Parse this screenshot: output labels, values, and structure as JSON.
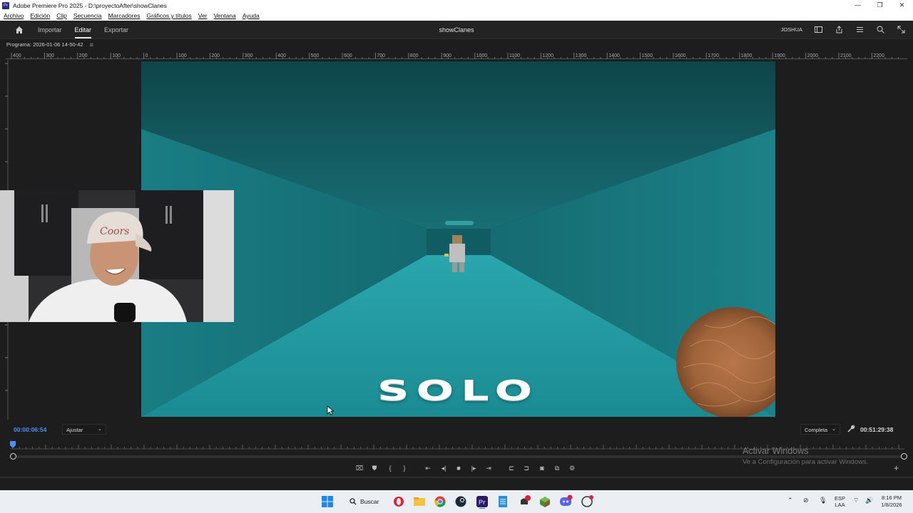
{
  "window": {
    "title": "Adobe Premiere Pro 2025 - D:\\proyectoAfter\\showClanes",
    "app_icon_label": "Pr"
  },
  "menu": [
    "Archivo",
    "Edición",
    "Clip",
    "Secuencia",
    "Marcadores",
    "Gráficos y títulos",
    "Ver",
    "Ventana",
    "Ayuda"
  ],
  "header": {
    "nav": [
      "Importar",
      "Editar",
      "Exportar"
    ],
    "active_nav": "Editar",
    "project_title": "showClanes",
    "user": "JOSHUA"
  },
  "program_panel": {
    "label": "Programa: 2026-01-06 14-50-42",
    "ruler_labels": [
      "400",
      "300",
      "200",
      "100",
      "0",
      "100",
      "200",
      "300",
      "400",
      "500",
      "600",
      "700",
      "800",
      "900",
      "1000",
      "1100",
      "1200",
      "1300",
      "1400",
      "1500",
      "1600",
      "1700",
      "1800",
      "1900",
      "2000",
      "2100",
      "2200"
    ],
    "overlay_text": "SOLO",
    "current_time": "00:00:06:54",
    "fit": "Ajustar",
    "quality": "Completa",
    "duration": "00:51:29:38"
  },
  "watermark": {
    "line1": "Activar Windows",
    "line2": "Ve a Configuración para activar Windows."
  },
  "taskbar": {
    "search": "Buscar",
    "lang": "ESP",
    "lang2": "LAA",
    "time": "8:16 PM",
    "date": "1/8/2026"
  },
  "colors": {
    "timecode": "#4f8ff7",
    "panel_bg": "#1d1d1d",
    "scene_teal": "#1d8f97"
  }
}
